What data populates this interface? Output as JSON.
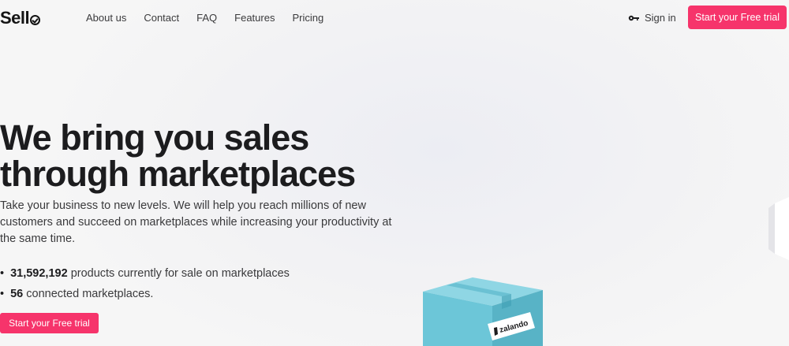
{
  "header": {
    "logo": "Sell",
    "nav": [
      "About us",
      "Contact",
      "FAQ",
      "Features",
      "Pricing"
    ],
    "signin_label": "Sign in",
    "cta_label": "Start your Free trial"
  },
  "hero": {
    "title_line1": "We bring you sales",
    "title_line2": "through marketplaces",
    "lead": "Take your business to new levels. We will help you reach millions of new customers and succeed on marketplaces while increasing your productivity at the same time.",
    "stats": [
      {
        "value": "31,592,192",
        "text": "products currently for sale on marketplaces"
      },
      {
        "value": "56",
        "text": "connected marketplaces."
      }
    ],
    "cta_label": "Start your Free trial",
    "box_label": "zalando"
  },
  "colors": {
    "accent": "#f6346b",
    "box": "#6cc6d8"
  }
}
